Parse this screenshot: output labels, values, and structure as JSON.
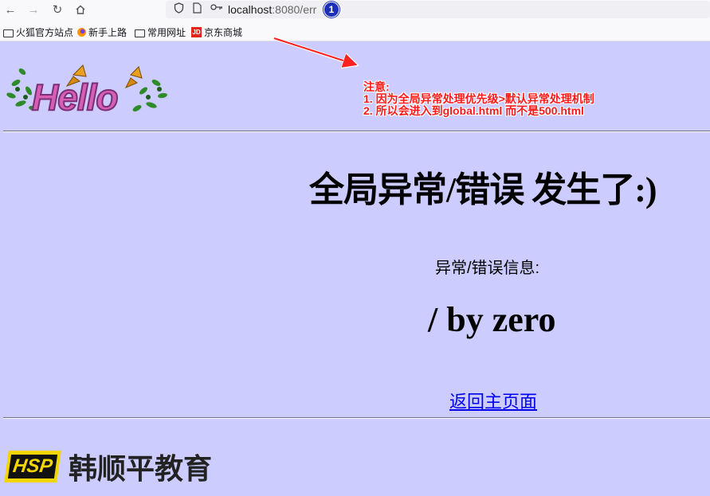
{
  "browser": {
    "url_host": "localhost",
    "url_rest": ":8080/err",
    "marker_number": "1",
    "bookmarks": [
      {
        "label": "火狐官方站点",
        "icon": "folder-icon"
      },
      {
        "label": "新手上路",
        "icon": "firefox-icon"
      },
      {
        "label": "常用网址",
        "icon": "folder-icon"
      },
      {
        "label": "京东商城",
        "icon": "jd-icon"
      }
    ]
  },
  "page": {
    "logo_text": "Hello",
    "annotation": {
      "line1": "注意:",
      "line2": "1. 因为全局异常处理优先级>默认异常处理机制",
      "line3": "2. 所以会进入到global.html 而不是500.html"
    },
    "heading": "全局异常/错误 发生了:)",
    "error_label": "异常/错误信息:",
    "error_message": "/ by zero",
    "home_link": "返回主页面",
    "footer_brand_badge": "HSP",
    "footer_brand_name": "韩顺平教育"
  },
  "colors": {
    "page_background": "#ccccff",
    "annotation": "#ff1a1a",
    "link": "#0000ee",
    "brand_yellow": "#f5d500"
  }
}
